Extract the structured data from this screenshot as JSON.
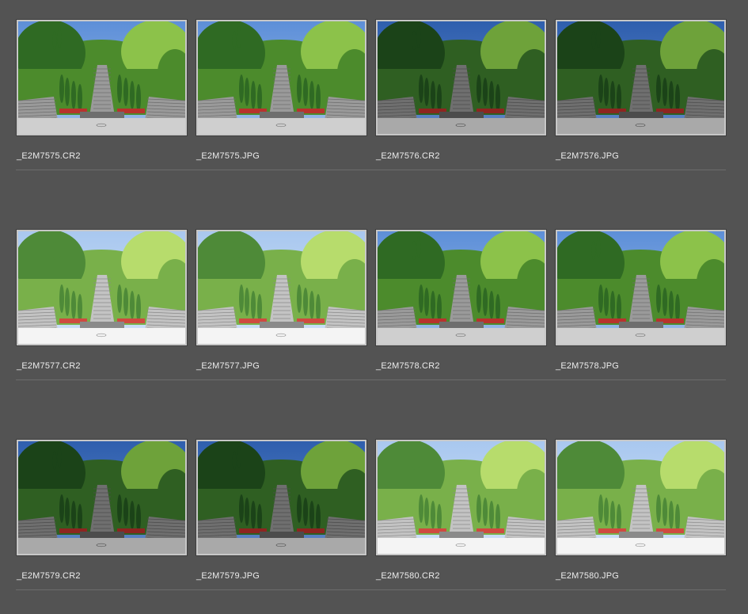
{
  "browser": {
    "rows": [
      {
        "items": [
          {
            "filename": "_E2M7575.CR2",
            "tone": "normal"
          },
          {
            "filename": "_E2M7575.JPG",
            "tone": "normal"
          },
          {
            "filename": "_E2M7576.CR2",
            "tone": "dark"
          },
          {
            "filename": "_E2M7576.JPG",
            "tone": "dark"
          }
        ]
      },
      {
        "items": [
          {
            "filename": "_E2M7577.CR2",
            "tone": "bright"
          },
          {
            "filename": "_E2M7577.JPG",
            "tone": "bright"
          },
          {
            "filename": "_E2M7578.CR2",
            "tone": "normal"
          },
          {
            "filename": "_E2M7578.JPG",
            "tone": "normal"
          }
        ]
      },
      {
        "items": [
          {
            "filename": "_E2M7579.CR2",
            "tone": "dark"
          },
          {
            "filename": "_E2M7579.JPG",
            "tone": "dark"
          },
          {
            "filename": "_E2M7580.CR2",
            "tone": "bright"
          },
          {
            "filename": "_E2M7580.JPG",
            "tone": "bright"
          }
        ]
      }
    ]
  },
  "colors": {
    "background": "#535353",
    "thumb_border": "#c7c7c7",
    "label_text": "#ececec",
    "divider": "#6c6c6c"
  }
}
